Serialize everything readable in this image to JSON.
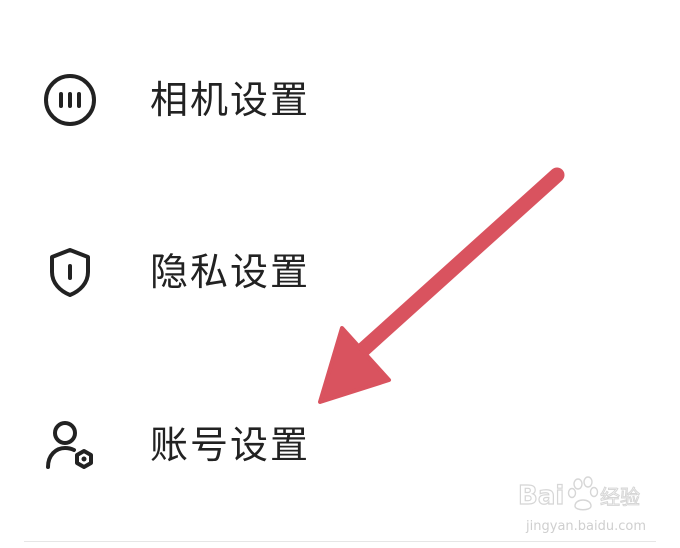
{
  "settings": {
    "items": [
      {
        "label": "相机设置",
        "icon": "camera-dots-icon"
      },
      {
        "label": "隐私设置",
        "icon": "shield-icon"
      },
      {
        "label": "账号设置",
        "icon": "user-settings-icon"
      }
    ]
  },
  "annotation": {
    "arrow_color": "#d9535f",
    "arrow_target": "账号设置"
  },
  "watermark": {
    "brand": "Bai 经验",
    "url": "jingyan.baidu.com"
  },
  "colors": {
    "text": "#222222",
    "icon_stroke": "#222222",
    "background": "#ffffff"
  }
}
